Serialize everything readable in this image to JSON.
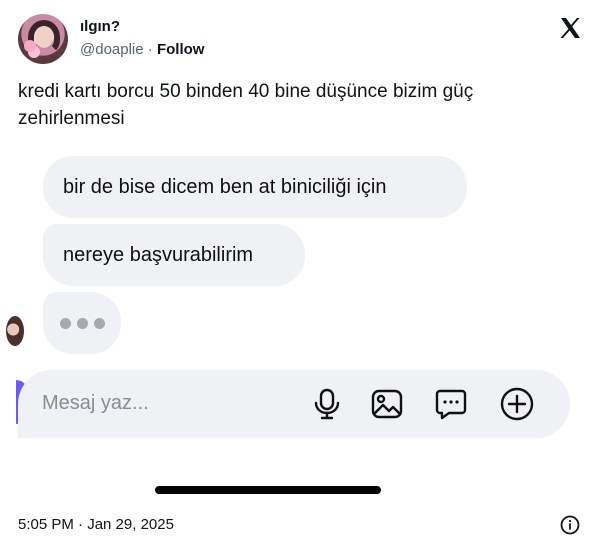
{
  "tweet": {
    "display_name": "ılgın?",
    "handle": "@doaplie",
    "separator": " · ",
    "follow_label": "Follow",
    "text": "kredi kartı borcu 50 binden 40 bine düşünce bizim güç zehirlenmesi",
    "timestamp": "5:05 PM · Jan 29, 2025",
    "icons": {
      "logo": "x-logo-icon",
      "info": "info-icon"
    }
  },
  "screenshot": {
    "messages": [
      {
        "text": "bir de bise dicem ben at biniciliği için"
      },
      {
        "text": "nereye başvurabilirim"
      }
    ],
    "typing_indicator": true,
    "composer": {
      "placeholder": "Mesaj yaz...",
      "icons": [
        "microphone-icon",
        "image-icon",
        "chat-icon",
        "plus-circle-icon"
      ]
    }
  },
  "colors": {
    "text": "#0f1419",
    "secondary": "#536471",
    "bubble": "#f0f1f4",
    "accent_edge": "#6b5cf0"
  }
}
